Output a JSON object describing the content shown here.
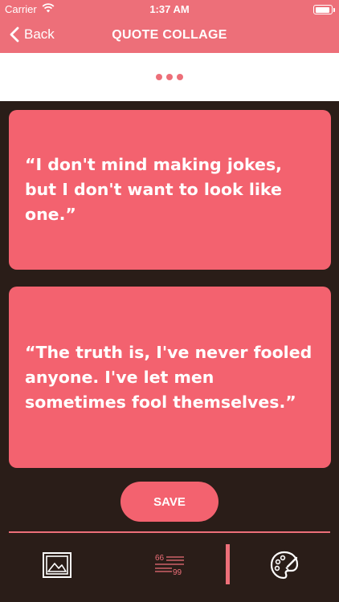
{
  "status_bar": {
    "carrier": "Carrier",
    "time": "1:37 AM",
    "battery_level": 0.9
  },
  "nav": {
    "back_label": "Back",
    "title": "QUOTE COLLAGE"
  },
  "quotes": [
    {
      "text": "“I don't mind making jokes, but I don't want to look like one.”"
    },
    {
      "text": "“The truth is, I've never fooled anyone. I've let men sometimes fool themselves.”"
    }
  ],
  "save_label": "SAVE",
  "colors": {
    "accent": "#ed6f79",
    "card": "#f3626f",
    "background": "#2a1d18"
  },
  "tabs": [
    {
      "icon": "image-icon"
    },
    {
      "icon": "text-format-icon",
      "text": "66 99"
    },
    {
      "icon": "palette-icon"
    }
  ]
}
